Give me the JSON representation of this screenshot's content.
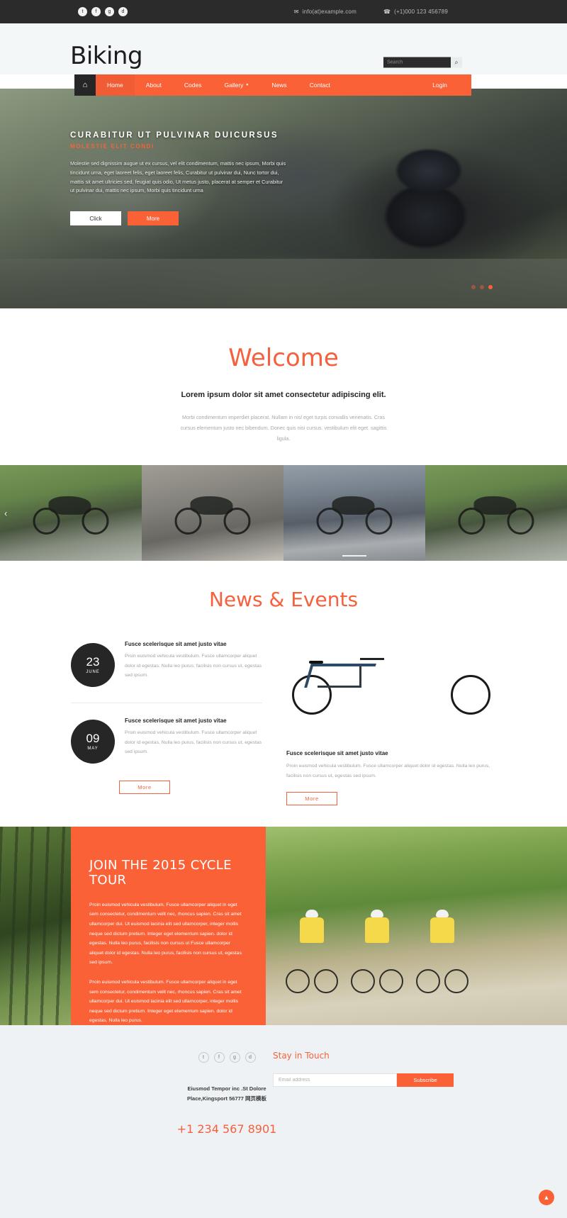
{
  "topbar": {
    "social": [
      {
        "name": "twitter-icon",
        "glyph": "t"
      },
      {
        "name": "facebook-icon",
        "glyph": "f"
      },
      {
        "name": "googleplus-icon",
        "glyph": "g"
      },
      {
        "name": "dribbble-icon",
        "glyph": "d"
      }
    ],
    "email": "info(at)example.com",
    "phone": "(+1)000 123 456789",
    "email_icon": "✉",
    "phone_icon": "☎"
  },
  "header": {
    "logo": "Biking",
    "search_placeholder": "Search",
    "search_value": "",
    "search_icon": "⌕"
  },
  "nav": {
    "home_icon": "⌂",
    "items": [
      {
        "label": "Home",
        "active": true
      },
      {
        "label": "About",
        "active": false
      },
      {
        "label": "Codes",
        "active": false
      },
      {
        "label": "Gallery",
        "active": false,
        "caret": "▼"
      },
      {
        "label": "News",
        "active": false
      },
      {
        "label": "Contact",
        "active": false
      }
    ],
    "login": "Login"
  },
  "hero": {
    "title": "CURABITUR UT PULVINAR DUICURSUS",
    "subtitle": "MOLESTIE ELIT CONDI",
    "text": "Molestie sed dignissim augue ut ex cursus, vel elit condimentum, mattis nec ipsum, Morbi quis tincidunt urna, eget laoreet felis, eget laoreet felis, Curabitur ut pulvinar dui, Nunc tortor dui, mattis sit amet ultricies sed, feugiat quis odio, Ut metus justo, placerat at semper et Curabitur ut pulvinar dui, mattis nec ipsum, Morbi quis tincidunt urna",
    "btn_click": "Click",
    "btn_more": "More",
    "dots": 3,
    "active_dot": 2
  },
  "welcome": {
    "title": "Welcome",
    "subtitle": "Lorem ipsum dolor sit amet consectetur adipiscing elit.",
    "text": "Morbi condimentum imperdiet placerat. Nullam in nisl eget turpis convallis venenatis. Cras cursus elementum justo nec bibendum. Donec quis nisi cursus. vestibulum elit eget. sagittis ligula."
  },
  "gallery": {
    "prev_icon": "‹",
    "slides": [
      "cyclist-road",
      "race-pack",
      "city-criterium",
      "cyclist-road-2"
    ]
  },
  "news": {
    "title": "News & Events",
    "items": [
      {
        "day": "23",
        "month": "JUNE",
        "heading": "Fusce scelerisque sit amet justo vitae",
        "text": "Proin euismod vehicula vestibulum. Fusce ullamcorper aliquet dolor id egestas. Nulla leo purus, facilisis non cursus ut, egestas sed ipsum."
      },
      {
        "day": "09",
        "month": "MAY",
        "heading": "Fusce scelerisque sit amet justo vitae",
        "text": "Proin euismod vehicula vestibulum. Fusce ullamcorper aliquet dolor id egestas. Nulla leo purus, facilisis non cursus ut, egestas sed ipsum."
      }
    ],
    "more_label": "More",
    "right": {
      "heading": "Fusce scelerisque sit amet justo vitae",
      "text": "Proin euismod vehicula vestibulum. Fusce ullamcorper aliquet dolor id egestas. Nulla leo purus, facilisis non cursus ut, egestas sed ipsum.",
      "more_label": "More"
    }
  },
  "cta": {
    "heading": "JOIN THE 2015 CYCLE TOUR",
    "paragraph1": "Proin euismod vehicula vestibulum. Fusce ullamcorper aliquet in eget sem consectetur, condimentum velit nec, rhoncus sapien. Cras sit amet ullamcorper dui. Ut euismod lacinia elit sed ullamcorper, integer mollis neque sed dictum pretium. Integer eget elementum sapien. dolor id egestas. Nulla leo purus, facilisis non cursus ut Fusce ullamcorper aliquet dolor id egestas. Nulla leo purus, facilisis non cursus ut, egestas sed ipsum.",
    "paragraph2": "Proin euismod vehicula vestibulum. Fusce ullamcorper aliquet in eget sem consectetur, condimentum velit nec, rhoncus sapien. Cras sit amet ullamcorper dui. Ut euismod lacinia elit sed ullamcorper, integer mollis neque sed dictum pretium. Integer eget elementum sapien. dolor id egestas. Nulla leo purus."
  },
  "footer": {
    "social": [
      {
        "name": "twitter-icon",
        "glyph": "t"
      },
      {
        "name": "facebook-icon",
        "glyph": "f"
      },
      {
        "name": "googleplus-icon",
        "glyph": "g"
      },
      {
        "name": "dribbble-icon",
        "glyph": "d"
      }
    ],
    "address_line1": "Eiusmod Tempor inc .St Dolore",
    "address_line2": "Place,Kingsport 56777 网页模板",
    "phone": "+1 234 567 8901",
    "newsletter_title": "Stay in Touch",
    "email_placeholder": "Email address",
    "email_value": "",
    "subscribe_label": "Subscribe",
    "totop_icon": "▲"
  },
  "colors": {
    "accent": "#fa6137",
    "accent_text": "#f4613c",
    "dark": "#2b2b2b",
    "footer_bg": "#eef2f4"
  }
}
